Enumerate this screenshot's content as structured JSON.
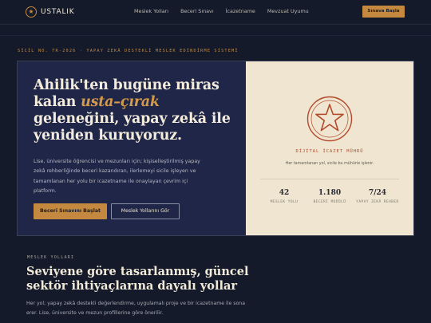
{
  "nav": {
    "brand": "USTALIK",
    "links": [
      "Meslek Yolları",
      "Beceri Sınavı",
      "İcazetname",
      "Mevzuat Uyumu"
    ],
    "cta": "Sınava Başla"
  },
  "hero": {
    "eyebrow": "SİCİL NO. TR-2026 · YAPAY ZEKÂ DESTEKLİ MESLEK EDİNDİRME SİSTEMİ",
    "headline_pre": "Ahilik'ten bugüne miras kalan ",
    "headline_accent": "usta–çırak",
    "headline_post": " geleneğini, yapay zekâ ile yeniden kuruyoruz.",
    "lede": "Lise, üniversite öğrencisi ve mezunları için; kişiselleştirilmiş yapay zekâ rehberliğinde beceri kazandıran, ilerlemeyi sicile işleyen ve tamamlanan her yolu bir icazetname ile onaylayan çevrim içi platform.",
    "primary_button": "Beceri Sınavını Başlat",
    "secondary_button": "Meslek Yollarını Gör"
  },
  "seal": {
    "title": "DİJİTAL İCAZET MÜHRÜ",
    "subtitle": "Her tamamlanan yol, sicile bu mühürle işlenir.",
    "stats": [
      {
        "value": "42",
        "label": "MESLEK YOLU"
      },
      {
        "value": "1.180",
        "label": "BECERİ MODÜLÜ"
      },
      {
        "value": "7/24",
        "label": "YAPAY ZEKÂ REHBER"
      }
    ]
  },
  "section": {
    "eyebrow": "MESLEK YOLLARI",
    "title": "Seviyene göre tasarlanmış, güncel sektör ihtiyaçlarına dayalı yollar",
    "body": "Her yol; yapay zekâ destekli değerlendirme, uygulamalı proje ve bir icazetname ile sona erer. Lise, üniversite ve mezun profillerine göre önerilir."
  },
  "colors": {
    "accent": "#c4893f",
    "seal": "#b24a2c",
    "background": "#141a2a",
    "panel": "#1f2647",
    "paper": "#efe5d0"
  },
  "icons": {
    "brand": "star-icon",
    "seal": "star-seal-icon"
  }
}
